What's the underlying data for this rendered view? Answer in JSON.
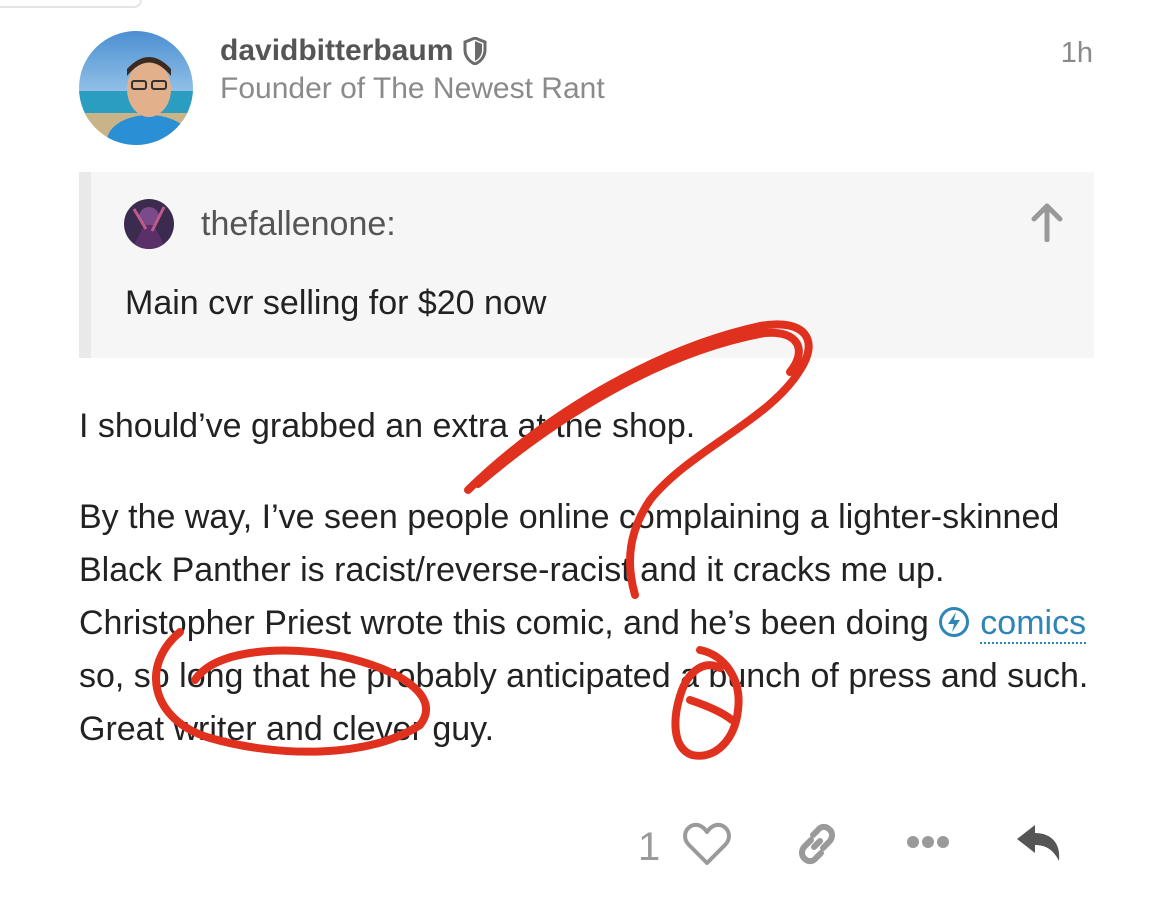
{
  "post": {
    "author": {
      "username": "davidbitterbaum",
      "title": "Founder of The Newest Rant",
      "badge_icon": "shield-icon"
    },
    "date": "1h",
    "quote": {
      "author": "thefallenone:",
      "text": "Main cvr selling for $20 now"
    },
    "paragraphs": {
      "p1": "I should’ve grabbed an extra at the shop.",
      "p2_before": "By the way, I’ve seen people online complaining a lighter-skinned Black Panther is racist/reverse-racist and it cracks me up. Christopher Priest wrote this comic, and he’s been doing",
      "hashtag": "comics",
      "p2_after": "so, so long that he probably anticipated a bunch of press and such. Great writer and clever guy."
    },
    "actions": {
      "like_count": "1",
      "icons": [
        "heart-icon",
        "link-icon",
        "more-icon",
        "reply-icon"
      ]
    }
  },
  "colors": {
    "link": "#2d86b8",
    "quote_bg": "#f6f6f6",
    "scribble": "#e0301e"
  }
}
